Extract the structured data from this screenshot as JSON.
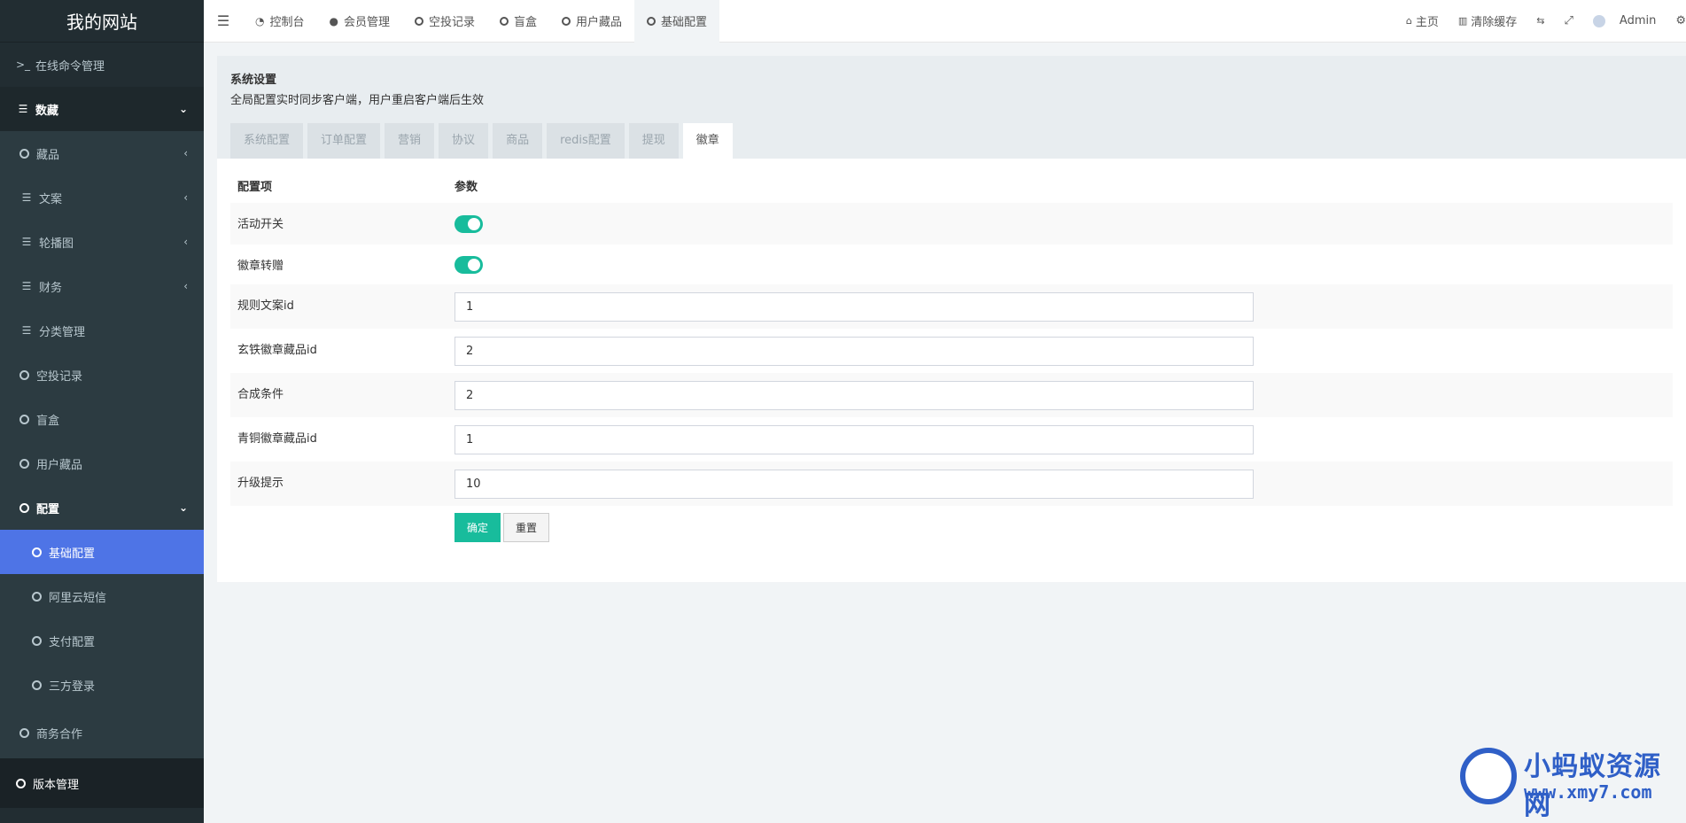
{
  "sidebar": {
    "title": "我的网站",
    "items": [
      {
        "label": "在线命令管理",
        "icon": "terminal-icon"
      },
      {
        "label": "数藏",
        "icon": "list-icon"
      },
      {
        "label": "藏品",
        "icon": "circle-icon"
      },
      {
        "label": "文案",
        "icon": "list-icon"
      },
      {
        "label": "轮播图",
        "icon": "list-icon"
      },
      {
        "label": "财务",
        "icon": "list-icon"
      },
      {
        "label": "分类管理",
        "icon": "list-icon"
      },
      {
        "label": "空投记录",
        "icon": "circle-icon"
      },
      {
        "label": "盲盒",
        "icon": "circle-icon"
      },
      {
        "label": "用户藏品",
        "icon": "circle-icon"
      },
      {
        "label": "配置",
        "icon": "circle-icon"
      },
      {
        "label": "基础配置",
        "icon": "circle-icon"
      },
      {
        "label": "阿里云短信",
        "icon": "circle-icon"
      },
      {
        "label": "支付配置",
        "icon": "circle-icon"
      },
      {
        "label": "三方登录",
        "icon": "circle-icon"
      },
      {
        "label": "商务合作",
        "icon": "circle-icon"
      },
      {
        "label": "版本管理",
        "icon": "circle-icon"
      }
    ]
  },
  "topbar": {
    "tabs": [
      {
        "label": "控制台",
        "icon": "dashboard-icon"
      },
      {
        "label": "会员管理",
        "icon": "user-icon"
      },
      {
        "label": "空投记录",
        "icon": "circle-icon"
      },
      {
        "label": "盲盒",
        "icon": "circle-icon"
      },
      {
        "label": "用户藏品",
        "icon": "circle-icon"
      },
      {
        "label": "基础配置",
        "icon": "circle-icon"
      }
    ],
    "home": "主页",
    "clear_cache": "清除缓存",
    "user": "Admin"
  },
  "panel": {
    "title": "系统设置",
    "desc": "全局配置实时同步客户端，用户重启客户端后生效",
    "tabs": [
      "系统配置",
      "订单配置",
      "营销",
      "协议",
      "商品",
      "redis配置",
      "提现",
      "徽章"
    ],
    "active_tab": "徽章",
    "col_key": "配置项",
    "col_value": "参数",
    "rows": [
      {
        "label": "活动开关",
        "type": "switch",
        "value": true
      },
      {
        "label": "徽章转赠",
        "type": "switch",
        "value": true
      },
      {
        "label": "规则文案id",
        "type": "text",
        "value": "1"
      },
      {
        "label": "玄铁徽章藏品id",
        "type": "text",
        "value": "2"
      },
      {
        "label": "合成条件",
        "type": "text",
        "value": "2"
      },
      {
        "label": "青铜徽章藏品id",
        "type": "text",
        "value": "1"
      },
      {
        "label": "升级提示",
        "type": "text",
        "value": "10"
      }
    ],
    "ok_label": "确定",
    "reset_label": "重置"
  },
  "watermark": {
    "line1": "小蚂蚁资源网",
    "line2": "www.xmy7.com"
  },
  "colors": {
    "accent": "#18bc9c",
    "active_menu": "#4e74e6",
    "sidebar_bg": "#222d32"
  }
}
